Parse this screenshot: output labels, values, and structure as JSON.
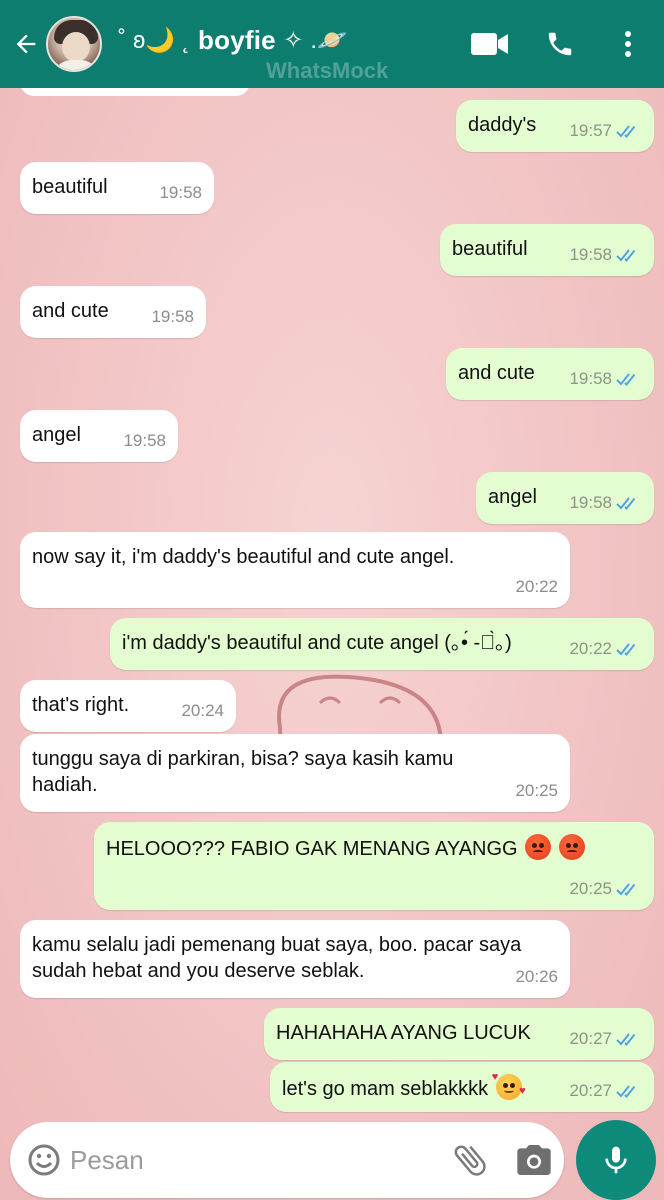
{
  "header": {
    "contact_name": "boyfie",
    "name_prefix": "˚ ʚ🌙 ˛",
    "name_suffix": "✧ .🪐",
    "watermark": "WhatsMock",
    "colors": {
      "header": "#0d7d6f",
      "outgoing": "#e3fdd1",
      "incoming": "#ffffff",
      "read_tick": "#4fa3e3"
    }
  },
  "messages": [
    {
      "direction": "out",
      "text": "daddy's",
      "time": "19:57",
      "read": true
    },
    {
      "direction": "in",
      "text": "beautiful",
      "time": "19:58"
    },
    {
      "direction": "out",
      "text": "beautiful",
      "time": "19:58",
      "read": true
    },
    {
      "direction": "in",
      "text": "and cute",
      "time": "19:58"
    },
    {
      "direction": "out",
      "text": "and cute",
      "time": "19:58",
      "read": true
    },
    {
      "direction": "in",
      "text": "angel",
      "time": "19:58"
    },
    {
      "direction": "out",
      "text": "angel",
      "time": "19:58",
      "read": true
    },
    {
      "direction": "in",
      "text": "now say it, i'm daddy's beautiful and cute angel.",
      "time": "20:22"
    },
    {
      "direction": "out",
      "text": "i'm daddy's beautiful and cute angel (｡•́ -ก̀｡)",
      "time": "20:22",
      "read": true
    },
    {
      "direction": "in",
      "text": "that's right.",
      "time": "20:24"
    },
    {
      "direction": "in",
      "text": "tunggu saya di parkiran, bisa? saya kasih kamu hadiah.",
      "time": "20:25"
    },
    {
      "direction": "out",
      "text": "HELOOO??? FABIO GAK MENANG AYANGG",
      "emoji": [
        "angry-face",
        "angry-face"
      ],
      "time": "20:25",
      "read": true
    },
    {
      "direction": "in",
      "text": "kamu selalu jadi pemenang buat saya, boo. pacar saya sudah hebat and you deserve seblak.",
      "time": "20:26"
    },
    {
      "direction": "out",
      "text": "HAHAHAHA AYANG LUCUK",
      "time": "20:27",
      "read": true
    },
    {
      "direction": "out",
      "text": "let's go mam seblakkkk",
      "emoji": [
        "smiling-face-with-hearts"
      ],
      "time": "20:27",
      "read": true
    }
  ],
  "composer": {
    "placeholder": "Pesan",
    "icons": [
      "emoji-icon",
      "attach-icon",
      "camera-icon",
      "mic-icon"
    ]
  }
}
